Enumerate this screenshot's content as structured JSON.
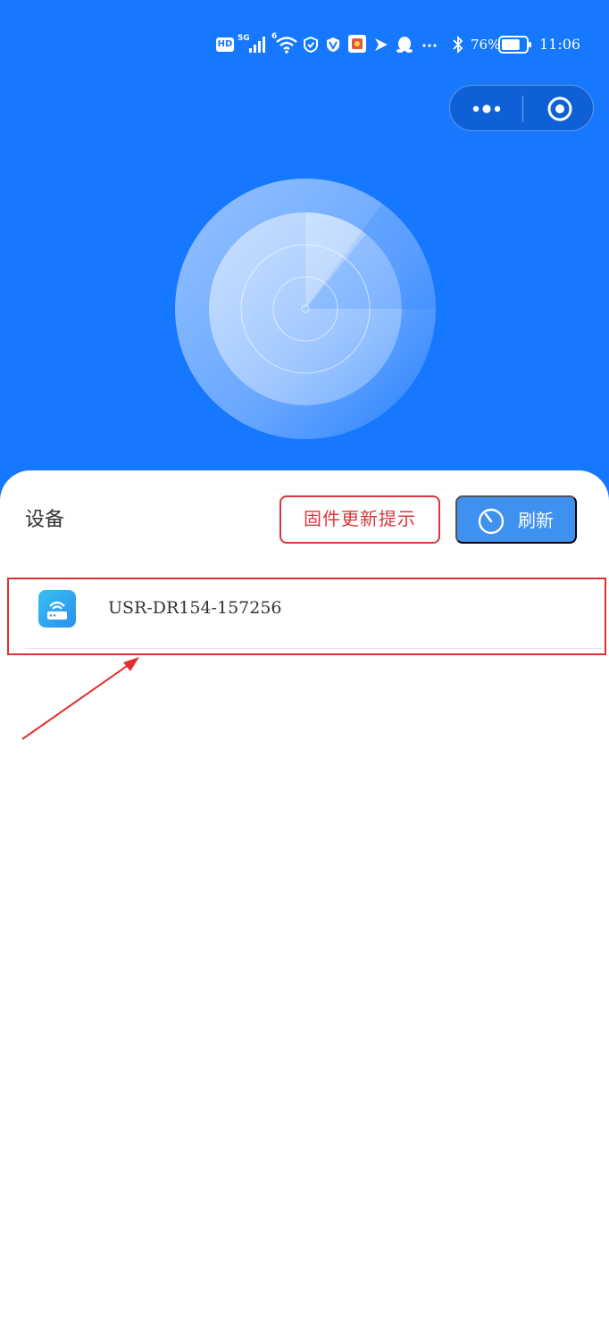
{
  "status_bar": {
    "hd": "HD",
    "net_5g": "5G",
    "net_6": "6",
    "battery_percent": "76%",
    "battery_level": 76,
    "time": "11:06",
    "icons": [
      "hd-icon",
      "signal-icon",
      "wifi-icon",
      "shield-app-icon",
      "security-app-icon",
      "game-app-icon",
      "bird-app-icon",
      "qq-icon",
      "more-dots-icon",
      "bluetooth-icon",
      "battery-icon"
    ]
  },
  "capsule": {
    "more_icon": "more-dots-icon",
    "close_icon": "close-circle-icon"
  },
  "devices_section": {
    "title": "设备",
    "firmware_button": "固件更新提示",
    "refresh_button": "刷新",
    "refresh_icon": "timer-icon"
  },
  "devices": [
    {
      "name": "USR-DR154-157256",
      "icon": "router-icon"
    }
  ],
  "colors": {
    "hero_blue": "#1677ff",
    "refresh_blue": "#3f91f0",
    "firmware_red": "#d9363e",
    "annotation_red": "#e23030"
  }
}
